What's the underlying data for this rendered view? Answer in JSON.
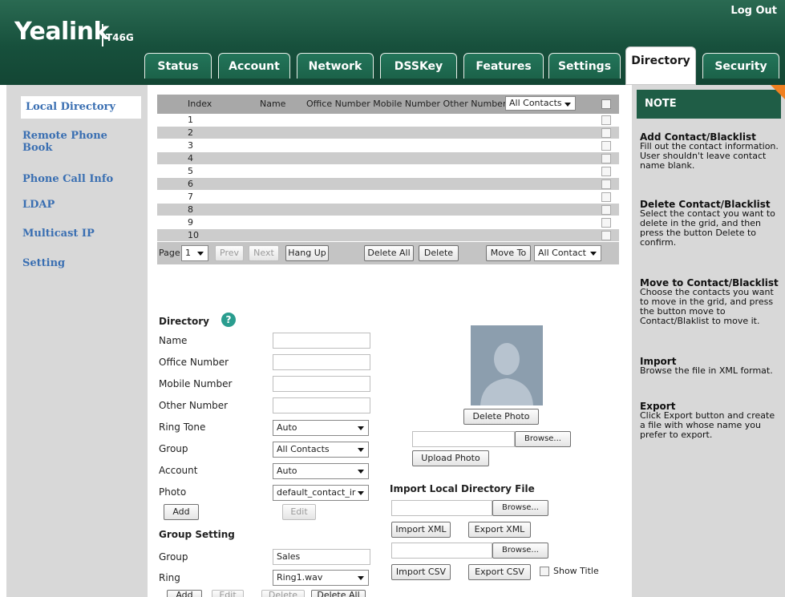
{
  "header": {
    "logo": "Yealink",
    "model": "T46G",
    "logout": "Log Out",
    "tabs": [
      "Status",
      "Account",
      "Network",
      "DSSKey",
      "Features",
      "Settings",
      "Directory",
      "Security"
    ],
    "active_tab": "Directory"
  },
  "sidebar": {
    "items": [
      "Local Directory",
      "Remote Phone Book",
      "Phone Call Info",
      "LDAP",
      "Multicast IP",
      "Setting"
    ],
    "active": "Local Directory"
  },
  "grid": {
    "headers": {
      "index": "Index",
      "name": "Name",
      "numbers": "Office Number Mobile Number Other Number"
    },
    "filter": "All Contacts",
    "rows": [
      "1",
      "2",
      "3",
      "4",
      "5",
      "6",
      "7",
      "8",
      "9",
      "10"
    ]
  },
  "pager": {
    "page_label": "Page",
    "page_value": "1",
    "prev": "Prev",
    "next": "Next",
    "hang_up": "Hang Up",
    "delete_all": "Delete All",
    "delete": "Delete",
    "move_to": "Move To",
    "move_target": "All Contact"
  },
  "directory": {
    "title": "Directory",
    "help_icon": "?",
    "fields": {
      "name": "Name",
      "office": "Office Number",
      "mobile": "Mobile Number",
      "other": "Other Number",
      "ring_tone": "Ring Tone",
      "group": "Group",
      "account": "Account",
      "photo": "Photo"
    },
    "values": {
      "ring_tone": "Auto",
      "group": "All Contacts",
      "account": "Auto",
      "photo": "default_contact_ir"
    },
    "add": "Add",
    "edit": "Edit"
  },
  "photo": {
    "delete_photo": "Delete Photo",
    "browse": "Browse...",
    "upload_photo": "Upload Photo"
  },
  "import": {
    "title": "Import Local Directory File",
    "browse": "Browse...",
    "import_xml": "Import XML",
    "export_xml": "Export XML",
    "import_csv": "Import CSV",
    "export_csv": "Export CSV",
    "show_title": "Show Title"
  },
  "group_setting": {
    "title": "Group Setting",
    "group_label": "Group",
    "group_value": "Sales",
    "ring_label": "Ring",
    "ring_value": "Ring1.wav",
    "add": "Add",
    "edit": "Edit",
    "delete": "Delete",
    "delete_all": "Delete All"
  },
  "note": {
    "header": "NOTE",
    "sections": [
      {
        "title": "Add Contact/Blacklist",
        "body": "Fill out the contact information. User shouldn't leave contact name blank."
      },
      {
        "title": "Delete Contact/Blacklist",
        "body": "Select the contact you want to delete in the grid, and then press the button Delete to confirm."
      },
      {
        "title": "Move to Contact/Blacklist",
        "body": "Choose the contacts you want to move in the grid, and press the button move to Contact/Blaklist to move it."
      },
      {
        "title": "Import",
        "body": "Browse the file in XML format."
      },
      {
        "title": "Export",
        "body": "Click Export button and create a file with whose name you prefer to export."
      }
    ]
  },
  "colors": {
    "header_green": "#17503c",
    "link_blue": "#3a6fb2",
    "note_corner": "#f08020",
    "help_icon": "#2a9d8f"
  }
}
